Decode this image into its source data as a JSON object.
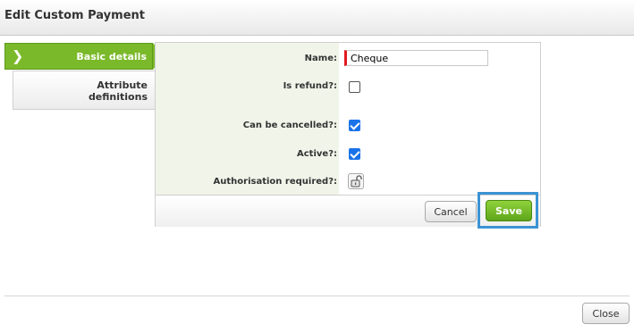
{
  "dialog": {
    "title": "Edit Custom Payment"
  },
  "nav": {
    "active_tab": "Basic details",
    "tabs": [
      {
        "label_line1": "Attribute",
        "label_line2": "definitions"
      }
    ]
  },
  "form": {
    "name_label": "Name:",
    "name_value": "Cheque",
    "is_refund_label": "Is refund?:",
    "is_refund_checked": false,
    "can_be_cancelled_label": "Can be cancelled?:",
    "can_be_cancelled_checked": true,
    "active_label": "Active?:",
    "active_checked": true,
    "authorisation_label": "Authorisation required?:",
    "authorisation_icon": "unlocked-padlock-icon"
  },
  "buttons": {
    "cancel": "Cancel",
    "save": "Save",
    "close": "Close"
  },
  "colors": {
    "accent_green": "#7ab929",
    "highlight_blue": "#3b93d3",
    "required_red": "#e0191f"
  }
}
